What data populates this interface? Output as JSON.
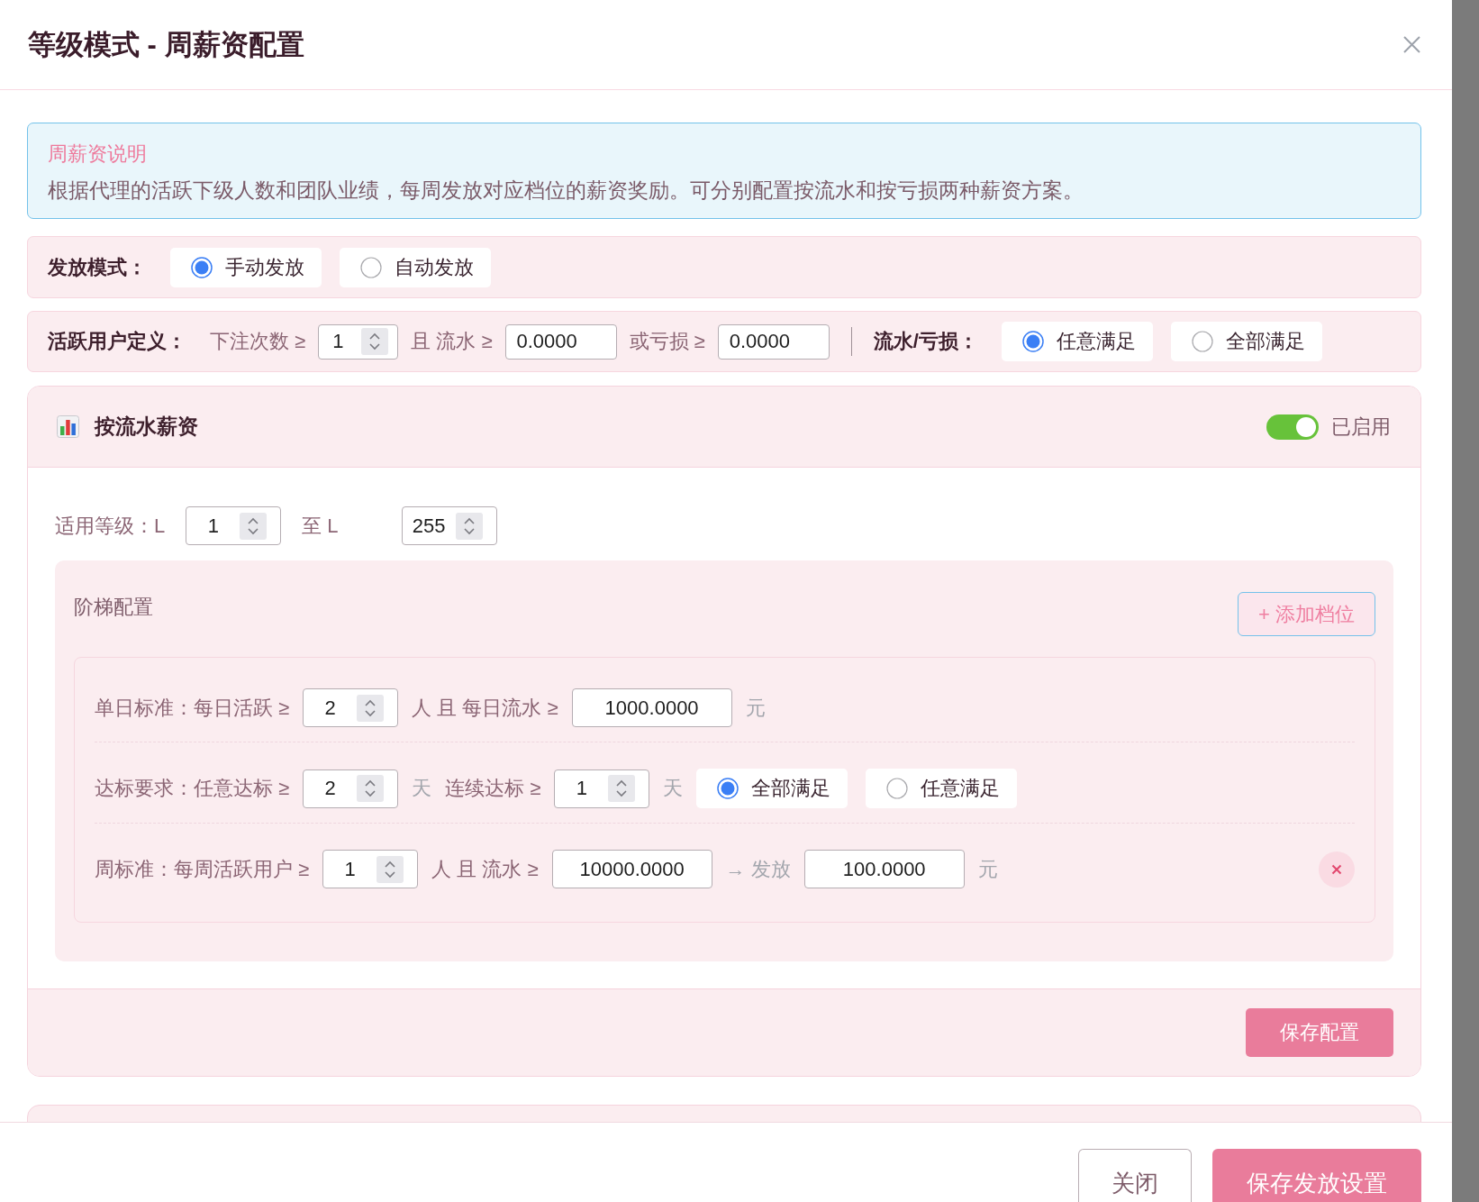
{
  "dialog": {
    "title": "等级模式 - 周薪资配置"
  },
  "notice": {
    "title": "周薪资说明",
    "text": "根据代理的活跃下级人数和团队业绩，每周发放对应档位的薪资奖励。可分别配置按流水和按亏损两种薪资方案。"
  },
  "payout_mode": {
    "label": "发放模式：",
    "options": [
      {
        "label": "手动发放",
        "selected": true
      },
      {
        "label": "自动发放",
        "selected": false
      }
    ]
  },
  "active_user": {
    "label": "活跃用户定义：",
    "conditions": [
      {
        "label": "下注次数 ≥",
        "kind": "stepper",
        "value": "1"
      },
      {
        "label": "且 流水 ≥",
        "kind": "input",
        "value": "0.0000"
      },
      {
        "label": "或亏损 ≥",
        "kind": "input",
        "value": "0.0000"
      }
    ],
    "match_label": "流水/亏损：",
    "match_options": [
      {
        "label": "任意满足",
        "selected": true
      },
      {
        "label": "全部满足",
        "selected": false
      }
    ]
  },
  "sections": [
    {
      "title": "按流水薪资",
      "enabled": true,
      "status": "已启用",
      "level_range": {
        "label": "适用等级：L",
        "from": "1",
        "separator": "至 L",
        "to": "255"
      },
      "tiers_title": "阶梯配置",
      "add_button": "+ 添加档位",
      "tiers": [
        {
          "rows": [
            {
              "items": [
                {
                  "kind": "label",
                  "text": "单日标准：每日活跃 ≥"
                },
                {
                  "kind": "stepper",
                  "value": "2"
                },
                {
                  "kind": "label",
                  "text": "人 且 每日流水 ≥"
                },
                {
                  "kind": "input",
                  "value": "1000.0000"
                },
                {
                  "kind": "unit",
                  "text": "元"
                }
              ]
            },
            {
              "items": [
                {
                  "kind": "label",
                  "text": "达标要求：任意达标 ≥"
                },
                {
                  "kind": "stepper",
                  "value": "2"
                },
                {
                  "kind": "unit",
                  "text": "天"
                },
                {
                  "kind": "label",
                  "text": "连续达标 ≥"
                },
                {
                  "kind": "stepper",
                  "value": "1"
                },
                {
                  "kind": "unit",
                  "text": "天"
                },
                {
                  "kind": "radio",
                  "options": [
                    {
                      "label": "全部满足",
                      "selected": true
                    },
                    {
                      "label": "任意满足",
                      "selected": false
                    }
                  ]
                }
              ]
            },
            {
              "items": [
                {
                  "kind": "label",
                  "text": "周标准：每周活跃用户 ≥"
                },
                {
                  "kind": "stepper",
                  "value": "1"
                },
                {
                  "kind": "label",
                  "text": "人 且 流水 ≥"
                },
                {
                  "kind": "input",
                  "value": "10000.0000"
                },
                {
                  "kind": "unit",
                  "text": "→ 发放"
                },
                {
                  "kind": "input",
                  "value": "100.0000"
                },
                {
                  "kind": "unit",
                  "text": "元"
                }
              ]
            }
          ]
        }
      ],
      "save_button": "保存配置"
    }
  ],
  "footer": {
    "buttons": [
      {
        "label": "关闭",
        "kind": "secondary"
      },
      {
        "label": "保存发放设置",
        "kind": "primary"
      }
    ]
  }
}
